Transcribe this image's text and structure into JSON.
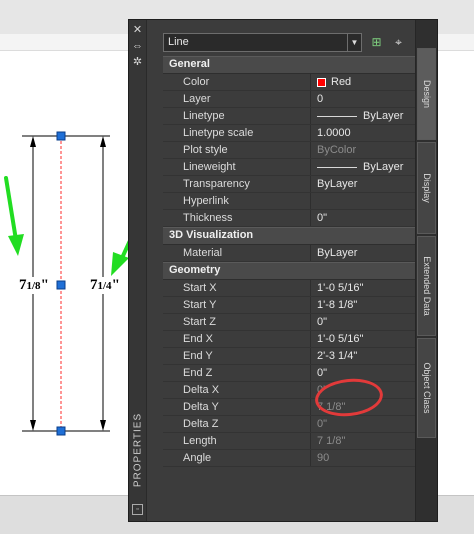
{
  "drawing": {
    "left_dim_text": "7",
    "left_dim_frac": "1/8",
    "left_dim_suffix": "\"",
    "right_dim_text": "7",
    "right_dim_frac": "1/4",
    "right_dim_suffix": "\""
  },
  "panel": {
    "vertical_title": "PROPERTIES",
    "object_type": "Line",
    "sections": {
      "general": "General",
      "visualization": "3D Visualization",
      "geometry": "Geometry"
    },
    "general": [
      {
        "key": "Color",
        "value": "Red"
      },
      {
        "key": "Layer",
        "value": "0"
      },
      {
        "key": "Linetype",
        "value": "ByLayer"
      },
      {
        "key": "Linetype scale",
        "value": "1.0000"
      },
      {
        "key": "Plot style",
        "value": "ByColor"
      },
      {
        "key": "Lineweight",
        "value": "ByLayer"
      },
      {
        "key": "Transparency",
        "value": "ByLayer"
      },
      {
        "key": "Hyperlink",
        "value": ""
      },
      {
        "key": "Thickness",
        "value": "0\""
      }
    ],
    "visualization": [
      {
        "key": "Material",
        "value": "ByLayer"
      }
    ],
    "geometry": [
      {
        "key": "Start X",
        "value": "1'-0 5/16\""
      },
      {
        "key": "Start Y",
        "value": "1'-8 1/8\""
      },
      {
        "key": "Start Z",
        "value": "0\""
      },
      {
        "key": "End X",
        "value": "1'-0 5/16\""
      },
      {
        "key": "End Y",
        "value": "2'-3 1/4\""
      },
      {
        "key": "End Z",
        "value": "0\""
      },
      {
        "key": "Delta X",
        "value": "0\""
      },
      {
        "key": "Delta Y",
        "value": "7 1/8\""
      },
      {
        "key": "Delta Z",
        "value": "0\""
      },
      {
        "key": "Length",
        "value": "7 1/8\""
      },
      {
        "key": "Angle",
        "value": "90"
      }
    ],
    "tabs": [
      "Design",
      "Display",
      "Extended Data",
      "Object Class"
    ],
    "collapse_symbol": "–"
  },
  "colors": {
    "accent_red": "#ff0000",
    "arrow_green": "#22dd22",
    "annotation_red": "#e23a3a",
    "grip_blue": "#1f6fd6"
  }
}
